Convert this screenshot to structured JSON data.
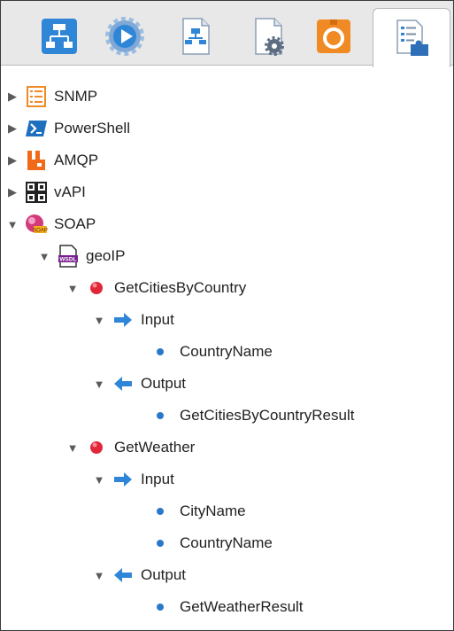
{
  "tabs": [
    {
      "icon": "topology-icon",
      "label": ""
    },
    {
      "icon": "play-gear-icon",
      "label": ""
    },
    {
      "icon": "workflow-document-icon",
      "label": ""
    },
    {
      "icon": "document-gear-icon",
      "label": ""
    },
    {
      "icon": "orange-package-icon",
      "label": ""
    },
    {
      "icon": "inventory-plugin-icon",
      "label": ""
    }
  ],
  "tree": {
    "snmp": "SNMP",
    "powershell": "PowerShell",
    "amqp": "AMQP",
    "vapi": "vAPI",
    "soap": "SOAP",
    "geoip": "geoIP",
    "op1": "GetCitiesByCountry",
    "op1_input": "Input",
    "op1_input_p1": "CountryName",
    "op1_output": "Output",
    "op1_output_p1": "GetCitiesByCountryResult",
    "op2": "GetWeather",
    "op2_input": "Input",
    "op2_input_p1": "CityName",
    "op2_input_p2": "CountryName",
    "op2_output": "Output",
    "op2_output_p1": "GetWeatherResult"
  },
  "icon_labels": {
    "wsdl": "WSDL",
    "soap": "SOAP"
  },
  "colors": {
    "accent_blue": "#2a78c9",
    "orange": "#f08a24",
    "red_operation": "#e0283a",
    "purple_wsdl": "#7a1f8f"
  }
}
